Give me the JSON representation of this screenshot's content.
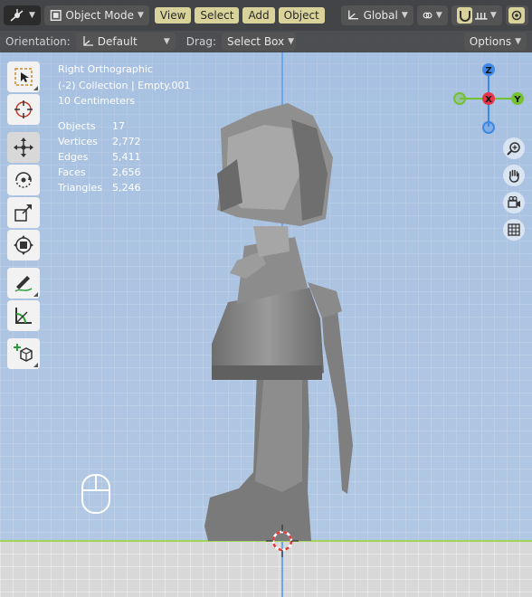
{
  "header": {
    "editor_type_icon": "orbit-gizmo-icon",
    "mode": "Object Mode",
    "menus": [
      "View",
      "Select",
      "Add",
      "Object"
    ],
    "transform_space": "Global",
    "colors": {
      "menu_highlight": "#d9d29a",
      "header_bg": "#3a3a3a"
    }
  },
  "subheader": {
    "orientation_label": "Orientation:",
    "orientation_value": "Default",
    "drag_label": "Drag:",
    "drag_value": "Select Box",
    "options_label": "Options"
  },
  "toolbar": {
    "tools": [
      "select-box-icon",
      "cursor-icon",
      "move-icon",
      "rotate-icon",
      "scale-icon",
      "transform-icon",
      "annotate-icon",
      "measure-icon",
      "add-cube-icon"
    ],
    "active_tool": "move-icon"
  },
  "overlay": {
    "view_name": "Right Orthographic",
    "collection": "(-2) Collection | Empty.001",
    "scale": "10 Centimeters"
  },
  "stats": [
    {
      "label": "Objects",
      "value": "17"
    },
    {
      "label": "Vertices",
      "value": "2,772"
    },
    {
      "label": "Edges",
      "value": "5,411"
    },
    {
      "label": "Faces",
      "value": "2,656"
    },
    {
      "label": "Triangles",
      "value": "5,246"
    }
  ],
  "gizmo": {
    "z_label": "Z",
    "x_label": "X",
    "y_label": "Y",
    "colors": {
      "x": "#e8354b",
      "y": "#74c131",
      "z": "#3d87e5"
    }
  },
  "nav_buttons": [
    "zoom-icon",
    "hand-pan-icon",
    "camera-icon",
    "grid-icon"
  ]
}
